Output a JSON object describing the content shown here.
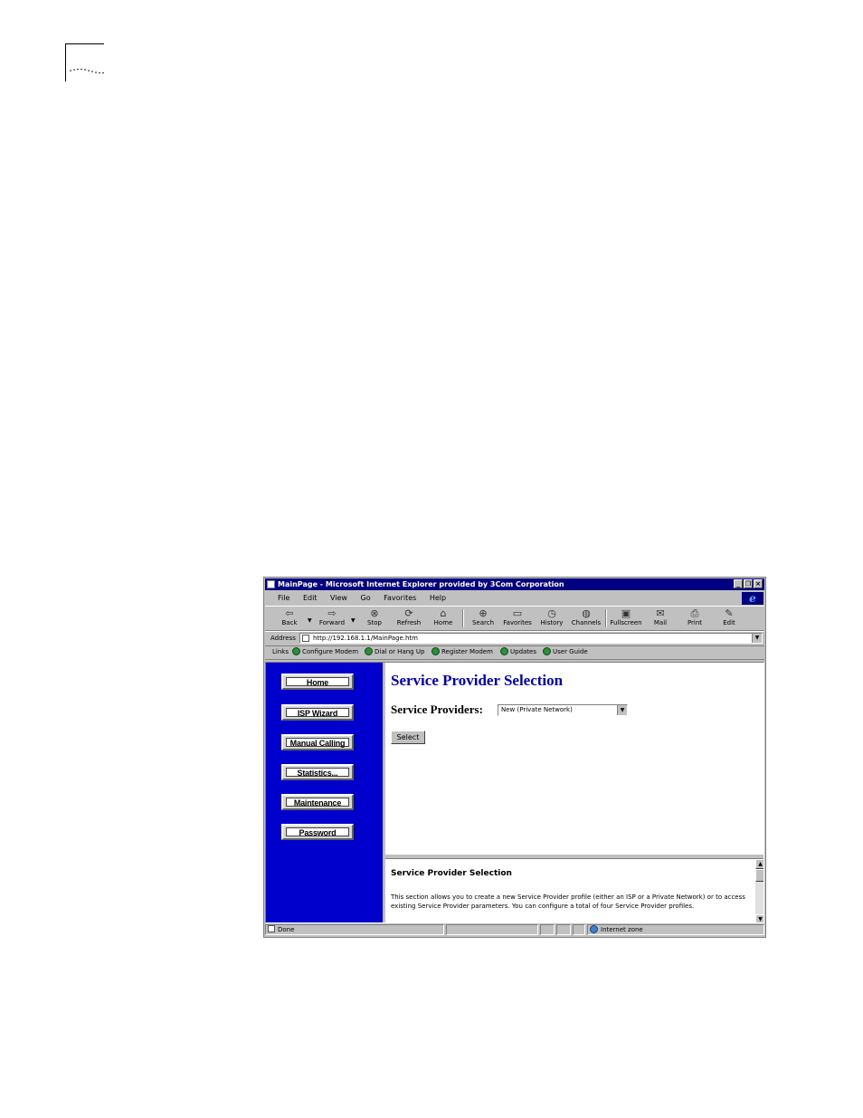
{
  "window": {
    "title": "MainPage - Microsoft Internet Explorer provided by 3Com Corporation"
  },
  "menu": [
    "File",
    "Edit",
    "View",
    "Go",
    "Favorites",
    "Help"
  ],
  "toolbar": [
    {
      "label": "Back",
      "icon": "back-arrow-icon"
    },
    {
      "label": "Forward",
      "icon": "forward-arrow-icon"
    },
    {
      "label": "Stop",
      "icon": "stop-icon"
    },
    {
      "label": "Refresh",
      "icon": "refresh-icon"
    },
    {
      "label": "Home",
      "icon": "home-icon"
    },
    {
      "label": "Search",
      "icon": "search-icon"
    },
    {
      "label": "Favorites",
      "icon": "favorites-icon"
    },
    {
      "label": "History",
      "icon": "history-icon"
    },
    {
      "label": "Channels",
      "icon": "channels-icon"
    },
    {
      "label": "Fullscreen",
      "icon": "fullscreen-icon"
    },
    {
      "label": "Mail",
      "icon": "mail-icon"
    },
    {
      "label": "Print",
      "icon": "print-icon"
    },
    {
      "label": "Edit",
      "icon": "edit-icon"
    }
  ],
  "address": {
    "label": "Address",
    "url": "http://192.168.1.1/MainPage.htm"
  },
  "links": {
    "label": "Links",
    "items": [
      "Configure Modem",
      "Dial or Hang Up",
      "Register Modem",
      "Updates",
      "User Guide"
    ]
  },
  "nav": [
    "Home",
    "ISP Wizard",
    "Manual Calling",
    "Statistics...",
    "Maintenance",
    "Password"
  ],
  "main": {
    "title": "Service Provider Selection",
    "providers_label": "Service Providers:",
    "providers_selected": "New (Private Network)",
    "select_button": "Select"
  },
  "help": {
    "title": "Service Provider Selection",
    "text": "This section allows you to create a new Service Provider profile (either an ISP or a Private Network) or to access existing Service Provider parameters. You can configure a total of four Service Provider profiles."
  },
  "status": {
    "text": "Done",
    "zone": "Internet zone"
  },
  "colors": {
    "title_bar": "#000080",
    "nav_background": "#0000cc",
    "page_title": "#0000c0"
  }
}
